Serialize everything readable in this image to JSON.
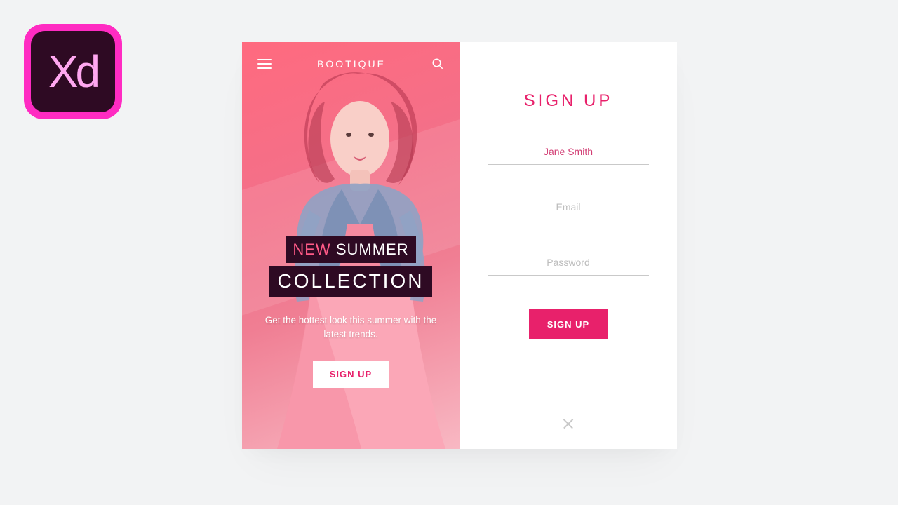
{
  "xd_icon_label": "Xd",
  "hero": {
    "brand": "BOOTIQUE",
    "headline_new": "NEW",
    "headline_summer": "SUMMER",
    "headline_collection": "COLLECTION",
    "tagline": "Get the hottest look this summer with the latest trends.",
    "cta": "SIGN UP"
  },
  "form": {
    "title": "SIGN UP",
    "name_value": "Jane Smith",
    "email_placeholder": "Email",
    "password_placeholder": "Password",
    "submit": "SIGN UP"
  }
}
